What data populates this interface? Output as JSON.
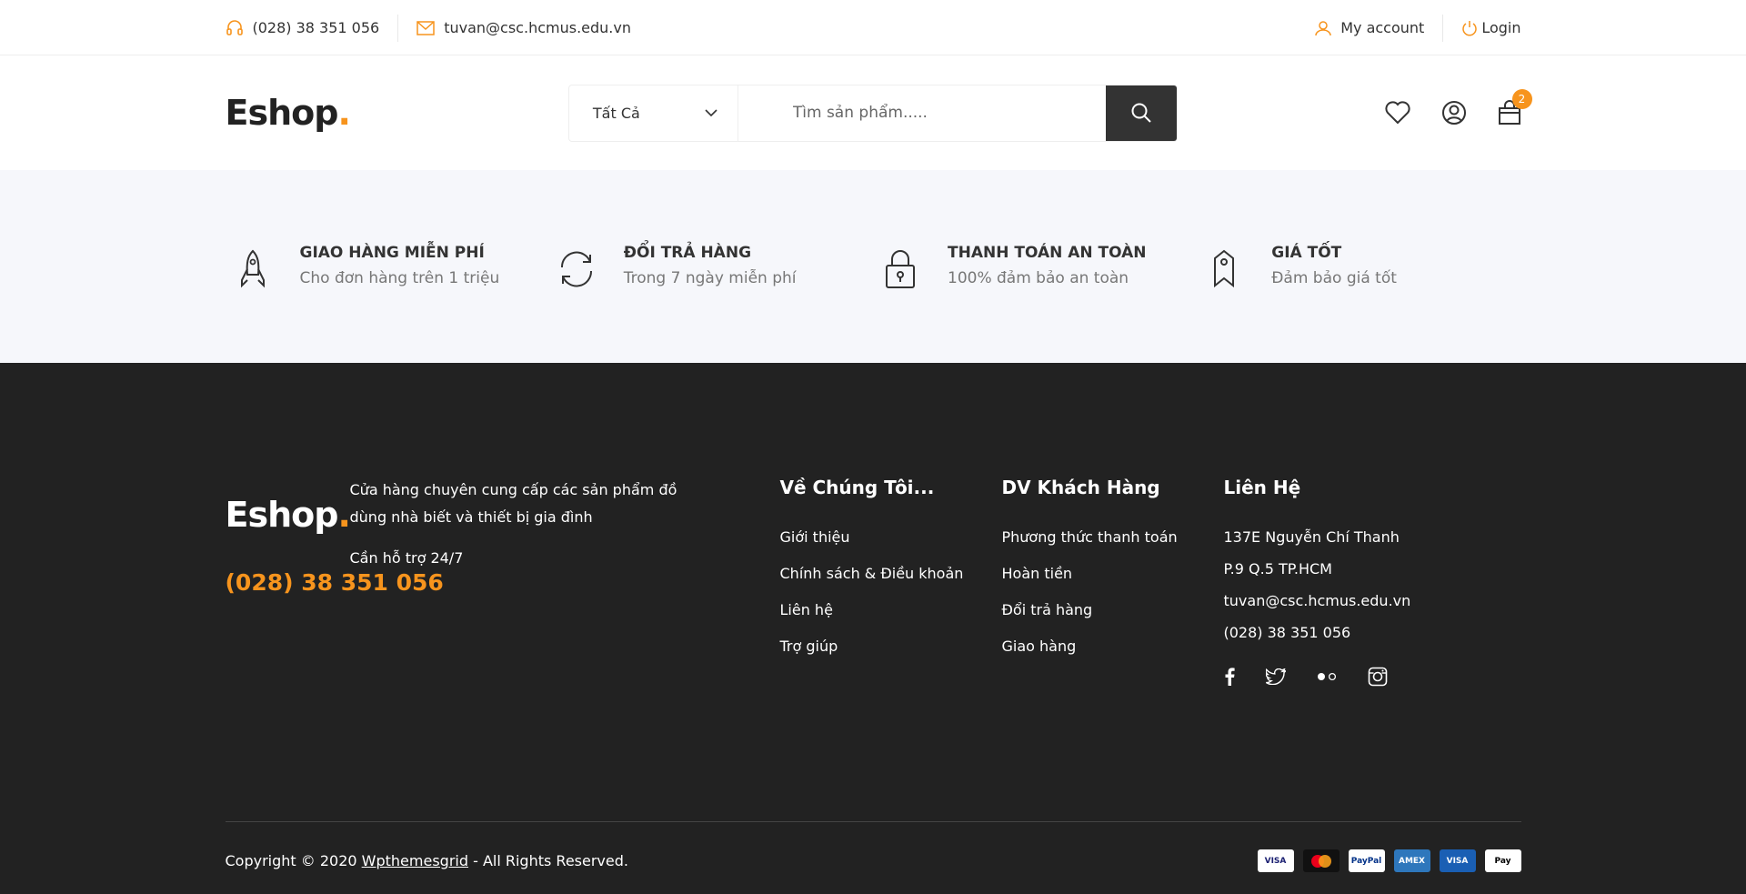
{
  "topbar": {
    "phone": "(028) 38 351 056",
    "email": "tuvan@csc.hcmus.edu.vn",
    "my_account": "My account",
    "login": "Login"
  },
  "header": {
    "logo_text": "Eshop",
    "logo_dot": ".",
    "category_selected": "Tất Cả",
    "search_placeholder": "Tìm sản phẩm.....",
    "cart_count": "2"
  },
  "services": [
    {
      "title": "GIAO HÀNG MIỄN PHÍ",
      "subtitle": "Cho đơn hàng trên 1 triệu",
      "icon": "rocket-icon"
    },
    {
      "title": "ĐỔI TRẢ HÀNG",
      "subtitle": "Trong 7 ngày miễn phí",
      "icon": "refresh-icon"
    },
    {
      "title": "THANH TOÁN AN TOÀN",
      "subtitle": "100% đảm bảo an toàn",
      "icon": "lock-icon"
    },
    {
      "title": "GIÁ TỐT",
      "subtitle": "Đảm bảo giá tốt",
      "icon": "tag-icon"
    }
  ],
  "footer": {
    "logo_text": "Eshop",
    "logo_dot": ".",
    "description": "Cửa hàng chuyên cung cấp các sản phẩm đồ dùng nhà biết và thiết bị gia đình",
    "support_label": "Cần hỗ trợ 24/7",
    "support_phone": "(028) 38 351 056",
    "about": {
      "title": "Về Chúng Tôi...",
      "links": [
        "Giới thiệu",
        "Chính sách & Điều khoản",
        "Liên hệ",
        "Trợ giúp"
      ]
    },
    "service": {
      "title": "DV Khách Hàng",
      "links": [
        "Phương thức thanh toán",
        "Hoàn tiền",
        "Đổi trả hàng",
        "Giao hàng"
      ]
    },
    "contact": {
      "title": "Liên Hệ",
      "lines": [
        "137E Nguyễn Chí Thanh",
        "P.9 Q.5 TP.HCM",
        "tuvan@csc.hcmus.edu.vn",
        "(028) 38 351 056"
      ]
    },
    "copyright_prefix": "Copyright © 2020 ",
    "copyright_link": "Wpthemesgrid",
    "copyright_suffix": " - All Rights Reserved.",
    "payments": [
      "VISA",
      "mastercard",
      "PayPal",
      "AMEX",
      "VISA",
      "Pay"
    ]
  },
  "colors": {
    "accent": "#F7941D",
    "dark": "#222222",
    "service_bg": "#F6F7FB"
  }
}
